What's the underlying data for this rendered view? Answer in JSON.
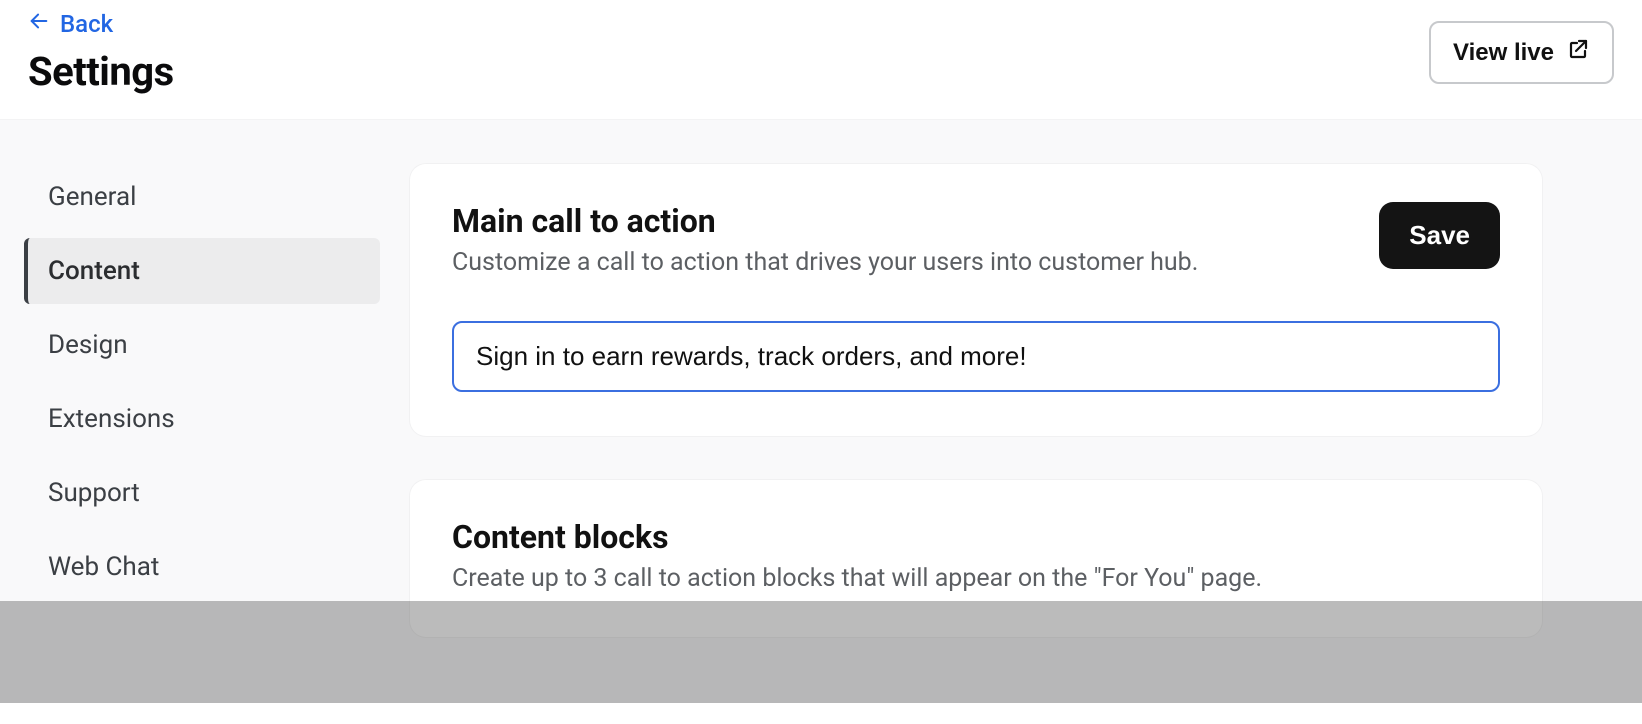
{
  "header": {
    "back_label": "Back",
    "title": "Settings",
    "view_live_label": "View live"
  },
  "sidebar": {
    "items": [
      {
        "label": "General",
        "active": false
      },
      {
        "label": "Content",
        "active": true
      },
      {
        "label": "Design",
        "active": false
      },
      {
        "label": "Extensions",
        "active": false
      },
      {
        "label": "Support",
        "active": false
      },
      {
        "label": "Web Chat",
        "active": false
      }
    ]
  },
  "main": {
    "cta_card": {
      "title": "Main call to action",
      "description": "Customize a call to action that drives your users into customer hub.",
      "save_label": "Save",
      "input_value": "Sign in to earn rewards, track orders, and more!"
    },
    "content_blocks_card": {
      "title": "Content blocks",
      "description": "Create up to 3 call to action blocks that will appear on the \"For You\" page."
    }
  }
}
